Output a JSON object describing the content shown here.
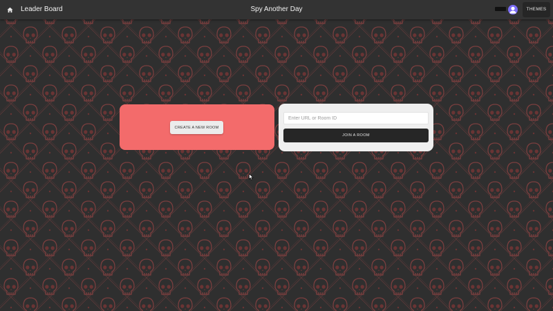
{
  "header": {
    "home_icon": "home-icon",
    "leaderboard_label": "Leader Board",
    "title": "Spy Another Day",
    "user_avatar_icon": "user-avatar-icon",
    "themes_label": "THEMES"
  },
  "background": {
    "pattern_icon": "skull-icon",
    "base_color": "#2f2f2f",
    "pattern_color": "#8a4545"
  },
  "create_panel": {
    "accent_color": "#f36b6b",
    "create_label": "CREATE A NEW ROOM"
  },
  "join_panel": {
    "input_value": "",
    "input_placeholder": "Enter URL or Room ID",
    "join_label": "JOIN A ROOM"
  }
}
